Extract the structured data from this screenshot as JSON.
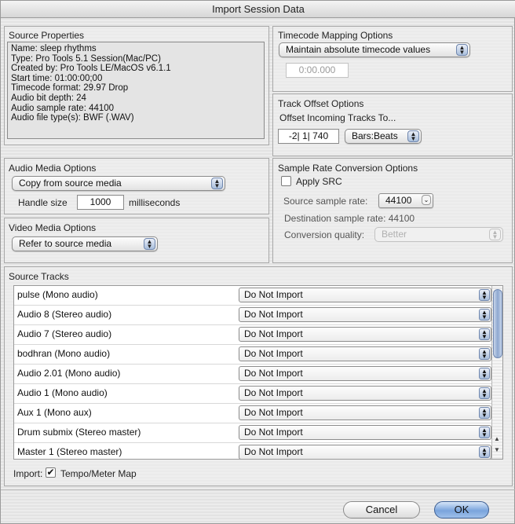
{
  "window": {
    "title": "Import Session Data"
  },
  "source_properties": {
    "title": "Source Properties",
    "lines": [
      "Name: sleep rhythms",
      "Type: Pro Tools 5.1 Session(Mac/PC)",
      "Created by: Pro Tools LE/MacOS v6.1.1",
      "Start time: 01:00:00;00",
      "Timecode format: 29.97 Drop",
      "Audio bit depth: 24",
      "Audio sample rate: 44100",
      "Audio file type(s): BWF (.WAV)"
    ]
  },
  "timecode_mapping": {
    "title": "Timecode Mapping Options",
    "selected": "Maintain absolute timecode values",
    "value": "0:00.000"
  },
  "track_offset": {
    "title": "Track Offset Options",
    "caption": "Offset Incoming Tracks To...",
    "value": "-2| 1| 740",
    "unit": "Bars:Beats"
  },
  "audio_media": {
    "title": "Audio Media Options",
    "selected": "Copy from source media",
    "handle_label": "Handle size",
    "handle_value": "1000",
    "handle_unit": "milliseconds"
  },
  "video_media": {
    "title": "Video Media Options",
    "selected": "Refer to source media"
  },
  "sample_rate": {
    "title": "Sample Rate Conversion Options",
    "apply_src_label": "Apply SRC",
    "apply_src_checked": false,
    "source_label": "Source sample rate:",
    "source_value": "44100",
    "destination_label": "Destination sample rate: 44100",
    "quality_label": "Conversion quality:",
    "quality_value": "Better"
  },
  "source_tracks": {
    "title": "Source Tracks",
    "rows": [
      {
        "name": "pulse (Mono audio)",
        "action": "Do Not Import"
      },
      {
        "name": "Audio 8 (Stereo audio)",
        "action": "Do Not Import"
      },
      {
        "name": "Audio 7 (Stereo audio)",
        "action": "Do Not Import"
      },
      {
        "name": "bodhran (Mono audio)",
        "action": "Do Not Import"
      },
      {
        "name": "Audio 2.01 (Mono audio)",
        "action": "Do Not Import"
      },
      {
        "name": "Audio 1 (Mono audio)",
        "action": "Do Not Import"
      },
      {
        "name": "Aux 1 (Mono aux)",
        "action": "Do Not Import"
      },
      {
        "name": "Drum submix (Stereo master)",
        "action": "Do Not Import"
      },
      {
        "name": "Master 1 (Stereo master)",
        "action": "Do Not Import"
      }
    ]
  },
  "import": {
    "label": "Import:",
    "option_label": "Tempo/Meter Map",
    "option_checked": true
  },
  "buttons": {
    "cancel": "Cancel",
    "ok": "OK"
  }
}
